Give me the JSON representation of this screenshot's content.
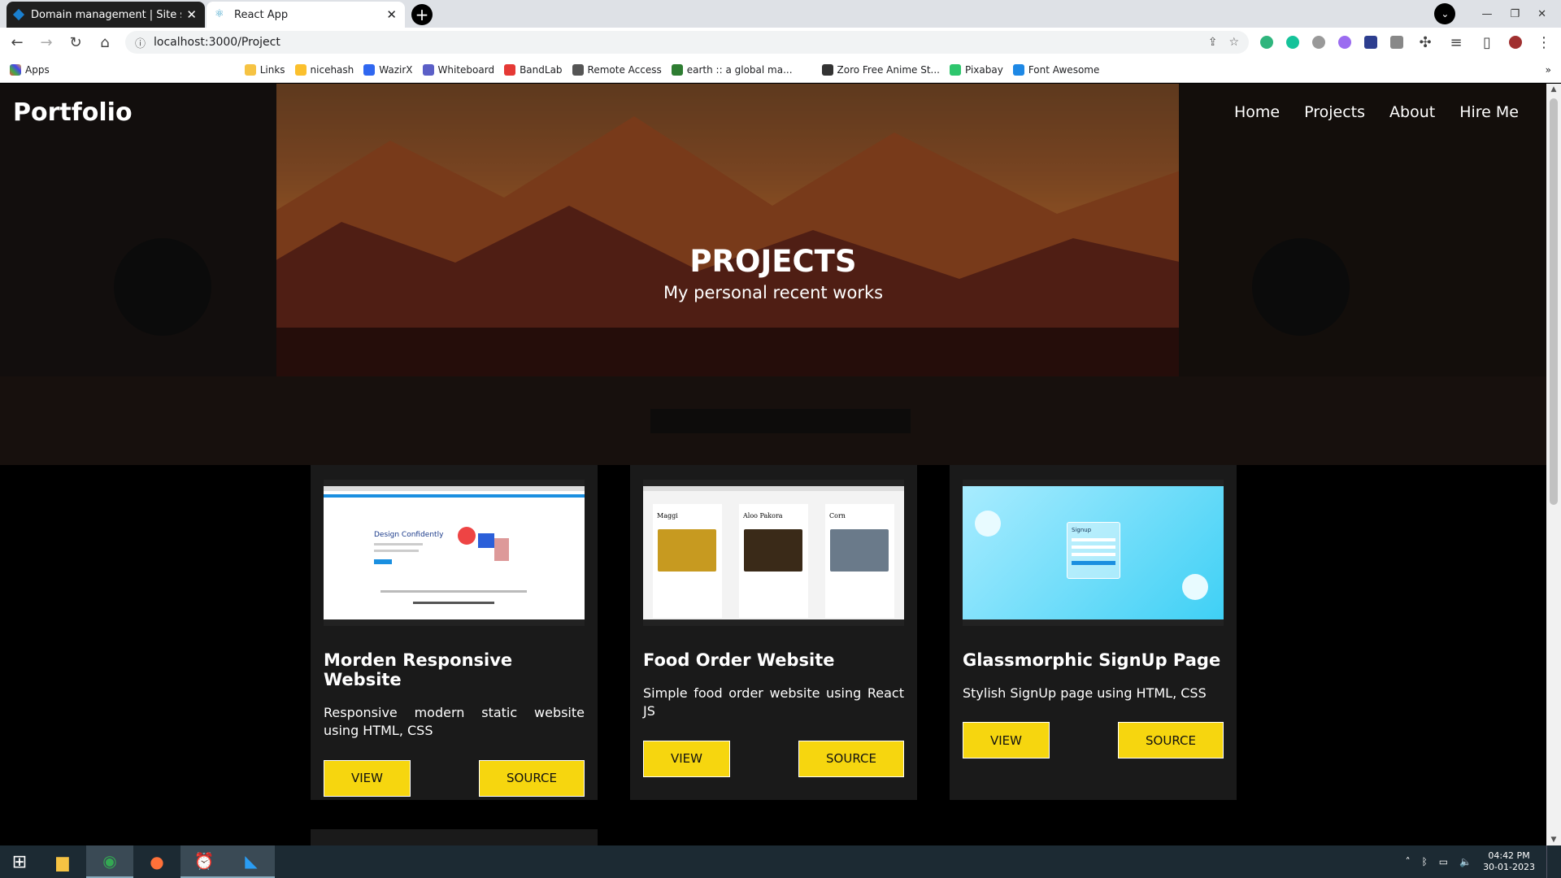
{
  "browser": {
    "tabs": [
      {
        "title": "Domain management | Site settin",
        "active": true
      },
      {
        "title": "React App",
        "active": false
      }
    ],
    "url": "localhost:3000/Project",
    "bookmarks": [
      "Apps",
      "Links",
      "nicehash",
      "WazirX",
      "Whiteboard",
      "BandLab",
      "Remote Access",
      "earth :: a global ma...",
      "Zoro Free Anime St...",
      "Pixabay",
      "Font Awesome"
    ]
  },
  "site": {
    "brand": "Portfolio",
    "nav": [
      "Home",
      "Projects",
      "About",
      "Hire Me"
    ],
    "hero_title": "PROJECTS",
    "hero_subtitle": "My personal recent works"
  },
  "projects": [
    {
      "title": "Morden Responsive Website",
      "desc": "Responsive modern static website using HTML, CSS",
      "view": "VIEW",
      "source": "SOURCE"
    },
    {
      "title": "Food Order Website",
      "desc": "Simple food order website using React JS",
      "view": "VIEW",
      "source": "SOURCE"
    },
    {
      "title": "Glassmorphic SignUp Page",
      "desc": "Stylish SignUp page using HTML, CSS",
      "view": "VIEW",
      "source": "SOURCE"
    }
  ],
  "thumb_text": {
    "p1_heading": "Design Confidently",
    "p2_items": [
      "Maggi",
      "Aloo Pakora",
      "Corn"
    ],
    "p3_form": "Signup"
  },
  "taskbar": {
    "time": "04:42 PM",
    "date": "30-01-2023"
  },
  "colors": {
    "accent": "#f6d60f",
    "card_bg": "#1a1a1a"
  }
}
